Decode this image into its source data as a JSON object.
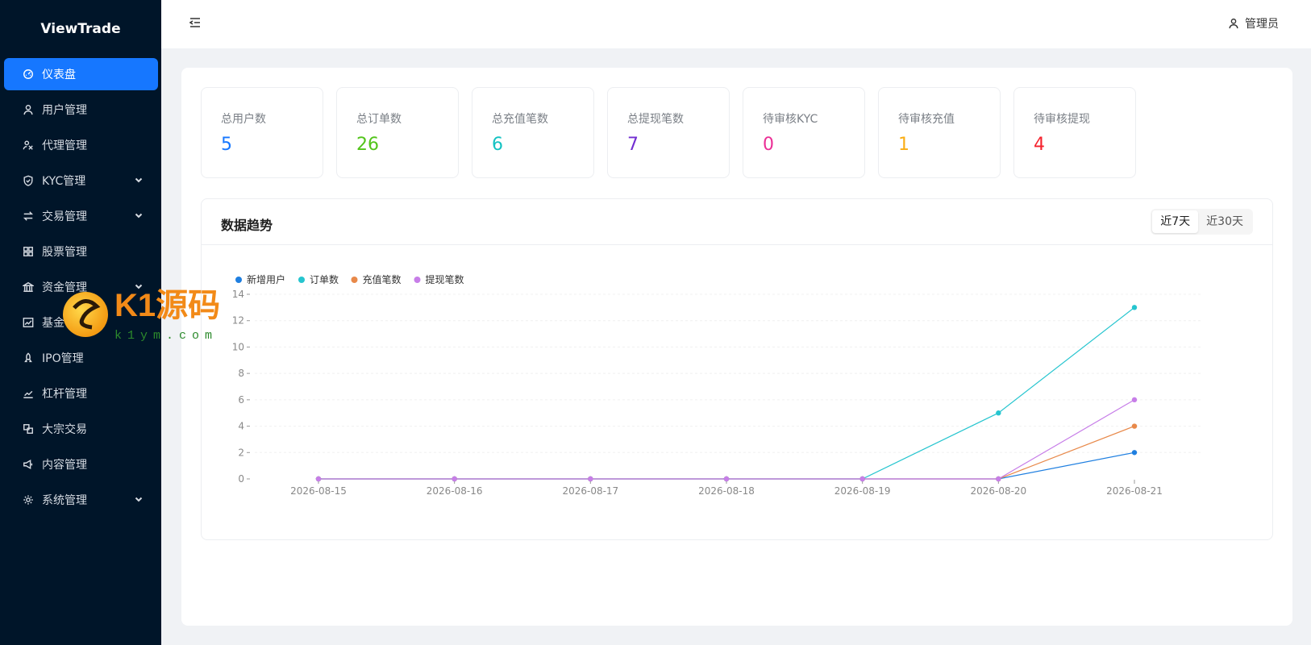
{
  "brand": "ViewTrade",
  "sidebar": {
    "items": [
      {
        "label": "仪表盘",
        "icon": "dashboard-icon",
        "active": true
      },
      {
        "label": "用户管理",
        "icon": "user-icon"
      },
      {
        "label": "代理管理",
        "icon": "agent-icon"
      },
      {
        "label": "KYC管理",
        "icon": "shield-icon",
        "expandable": true
      },
      {
        "label": "交易管理",
        "icon": "swap-icon",
        "expandable": true
      },
      {
        "label": "股票管理",
        "icon": "grid-icon"
      },
      {
        "label": "资金管理",
        "icon": "bank-icon",
        "expandable": true
      },
      {
        "label": "基金管理",
        "icon": "fund-chart-icon"
      },
      {
        "label": "IPO管理",
        "icon": "rocket-icon"
      },
      {
        "label": "杠杆管理",
        "icon": "line-chart-icon"
      },
      {
        "label": "大宗交易",
        "icon": "block-icon"
      },
      {
        "label": "内容管理",
        "icon": "notification-icon"
      },
      {
        "label": "系统管理",
        "icon": "gear-icon",
        "expandable": true
      }
    ]
  },
  "header": {
    "user_label": "管理员"
  },
  "stats": [
    {
      "label": "总用户数",
      "value": "5",
      "color": "#1677ff"
    },
    {
      "label": "总订单数",
      "value": "26",
      "color": "#52c41a"
    },
    {
      "label": "总充值笔数",
      "value": "6",
      "color": "#13c2c2"
    },
    {
      "label": "总提现笔数",
      "value": "7",
      "color": "#722ed1"
    },
    {
      "label": "待审核KYC",
      "value": "0",
      "color": "#eb2f96"
    },
    {
      "label": "待审核充值",
      "value": "1",
      "color": "#faad14"
    },
    {
      "label": "待审核提现",
      "value": "4",
      "color": "#f5222d"
    }
  ],
  "trend": {
    "title": "数据趋势",
    "ranges": [
      "近7天",
      "近30天"
    ],
    "selected_range": "近7天"
  },
  "watermark": {
    "text": "K1源码",
    "subtext": "k1ym.com"
  },
  "chart_data": {
    "type": "line",
    "categories": [
      "2026-08-15",
      "2026-08-16",
      "2026-08-17",
      "2026-08-18",
      "2026-08-19",
      "2026-08-20",
      "2026-08-21"
    ],
    "ylim": [
      0,
      14
    ],
    "yticks": [
      0,
      2,
      4,
      6,
      8,
      10,
      12,
      14
    ],
    "grid": true,
    "legend_position": "top-left",
    "series": [
      {
        "name": "新增用户",
        "color": "#1f7fe0",
        "values": [
          0,
          0,
          0,
          0,
          0,
          0,
          2
        ]
      },
      {
        "name": "订单数",
        "color": "#26c5cf",
        "values": [
          0,
          0,
          0,
          0,
          0,
          5,
          13
        ]
      },
      {
        "name": "充值笔数",
        "color": "#e8894a",
        "values": [
          0,
          0,
          0,
          0,
          0,
          0,
          4
        ]
      },
      {
        "name": "提现笔数",
        "color": "#c77ee8",
        "values": [
          0,
          0,
          0,
          0,
          0,
          0,
          6
        ]
      }
    ]
  }
}
